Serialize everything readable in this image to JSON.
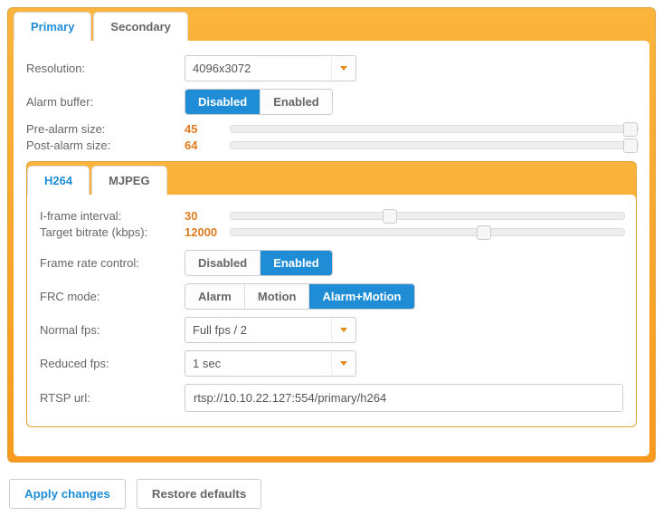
{
  "outer_tabs": {
    "primary": "Primary",
    "secondary": "Secondary"
  },
  "labels": {
    "resolution": "Resolution:",
    "alarm_buffer": "Alarm buffer:",
    "pre_alarm": "Pre-alarm size:",
    "post_alarm": "Post-alarm size:",
    "iframe": "I-frame interval:",
    "bitrate": "Target bitrate (kbps):",
    "frc": "Frame rate control:",
    "frc_mode": "FRC mode:",
    "normal_fps": "Normal fps:",
    "reduced_fps": "Reduced fps:",
    "rtsp": "RTSP url:"
  },
  "values": {
    "resolution": "4096x3072",
    "pre_alarm": "45",
    "post_alarm": "64",
    "iframe": "30",
    "bitrate": "12000",
    "normal_fps": "Full fps / 2",
    "reduced_fps": "1 sec",
    "rtsp": "rtsp://10.10.22.127:554/primary/h264"
  },
  "toggles": {
    "disabled": "Disabled",
    "enabled": "Enabled",
    "alarm": "Alarm",
    "motion": "Motion",
    "alarm_motion": "Alarm+Motion"
  },
  "codec_tabs": {
    "h264": "H264",
    "mjpeg": "MJPEG"
  },
  "actions": {
    "apply": "Apply changes",
    "restore": "Restore defaults"
  }
}
